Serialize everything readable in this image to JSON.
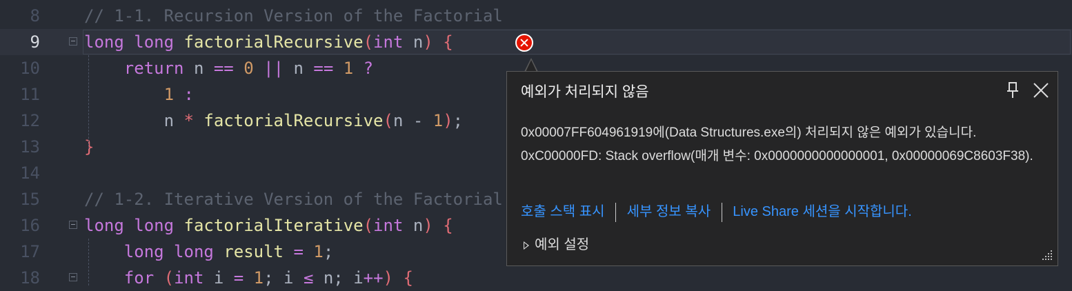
{
  "editor": {
    "lines": [
      {
        "num": "8",
        "tokens": [
          {
            "t": "// 1-1. Recursion Version of the Factorial",
            "c": "com"
          }
        ]
      },
      {
        "num": "9",
        "tokens": [
          {
            "t": "long long ",
            "c": "kw"
          },
          {
            "t": "factorialRecursive",
            "c": "fn"
          },
          {
            "t": "(",
            "c": "par"
          },
          {
            "t": "int",
            "c": "kw"
          },
          {
            "t": " n",
            "c": "id"
          },
          {
            "t": ")",
            "c": "par"
          },
          {
            "t": " {",
            "c": "par"
          }
        ]
      },
      {
        "num": "10",
        "tokens": [
          {
            "t": "    return",
            "c": "kw"
          },
          {
            "t": " n ",
            "c": "id"
          },
          {
            "t": "==",
            "c": "op"
          },
          {
            "t": " 0 ",
            "c": "num"
          },
          {
            "t": "||",
            "c": "op"
          },
          {
            "t": " n ",
            "c": "id"
          },
          {
            "t": "==",
            "c": "op"
          },
          {
            "t": " 1 ",
            "c": "num"
          },
          {
            "t": "?",
            "c": "op"
          }
        ]
      },
      {
        "num": "11",
        "tokens": [
          {
            "t": "        1 ",
            "c": "num"
          },
          {
            "t": ":",
            "c": "op"
          }
        ]
      },
      {
        "num": "12",
        "tokens": [
          {
            "t": "        n ",
            "c": "id"
          },
          {
            "t": "*",
            "c": "ops"
          },
          {
            "t": " factorialRecursive",
            "c": "fn"
          },
          {
            "t": "(",
            "c": "par"
          },
          {
            "t": "n - ",
            "c": "id"
          },
          {
            "t": "1",
            "c": "num"
          },
          {
            "t": ")",
            "c": "par"
          },
          {
            "t": ";",
            "c": "id"
          }
        ]
      },
      {
        "num": "13",
        "tokens": [
          {
            "t": "}",
            "c": "par"
          }
        ]
      },
      {
        "num": "14",
        "tokens": []
      },
      {
        "num": "15",
        "tokens": [
          {
            "t": "// 1-2. Iterative Version of the Factorial",
            "c": "com"
          }
        ]
      },
      {
        "num": "16",
        "tokens": [
          {
            "t": "long long ",
            "c": "kw"
          },
          {
            "t": "factorialIterative",
            "c": "fn"
          },
          {
            "t": "(",
            "c": "par"
          },
          {
            "t": "int",
            "c": "kw"
          },
          {
            "t": " n",
            "c": "id"
          },
          {
            "t": ")",
            "c": "par"
          },
          {
            "t": " {",
            "c": "par"
          }
        ]
      },
      {
        "num": "17",
        "tokens": [
          {
            "t": "    long long ",
            "c": "kw"
          },
          {
            "t": "result",
            "c": "fn"
          },
          {
            "t": " = ",
            "c": "op"
          },
          {
            "t": "1",
            "c": "num"
          },
          {
            "t": ";",
            "c": "id"
          }
        ]
      },
      {
        "num": "18",
        "tokens": [
          {
            "t": "    for",
            "c": "kw"
          },
          {
            "t": " (",
            "c": "par"
          },
          {
            "t": "int",
            "c": "kw"
          },
          {
            "t": " i ",
            "c": "id"
          },
          {
            "t": "=",
            "c": "op"
          },
          {
            "t": " 1",
            "c": "num"
          },
          {
            "t": "; i ",
            "c": "id"
          },
          {
            "t": "≤",
            "c": "op"
          },
          {
            "t": " n; i",
            "c": "id"
          },
          {
            "t": "++",
            "c": "op"
          },
          {
            "t": ") {",
            "c": "par"
          }
        ]
      }
    ],
    "current_line": "9"
  },
  "exception_popup": {
    "title": "예외가 처리되지 않음",
    "message": "0x00007FF604961919에(Data Structures.exe의) 처리되지 않은 예외가 있습니다. 0xC00000FD: Stack overflow(매개 변수: 0x0000000000000001, 0x00000069C8603F38).",
    "links": {
      "call_stack": "호출 스택 표시",
      "copy_details": "세부 정보 복사",
      "live_share": "Live Share 세션을 시작합니다."
    },
    "settings_label": "예외 설정",
    "icons": {
      "pin": "pin-icon",
      "close": "close-icon",
      "error": "error-icon",
      "grip": "resize-grip-icon"
    }
  },
  "colors": {
    "background": "#282c34",
    "error": "#e51400",
    "link": "#3794ff",
    "popup_bg": "#252526"
  }
}
